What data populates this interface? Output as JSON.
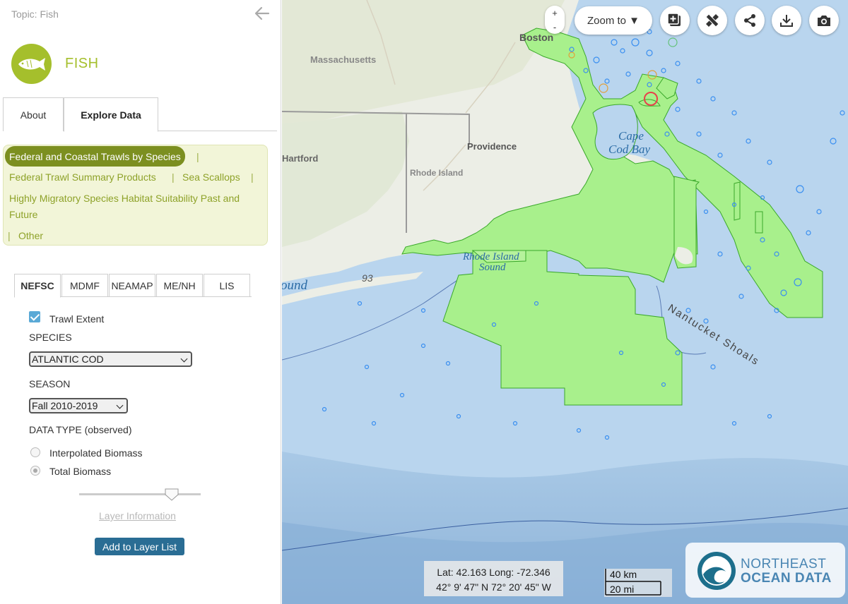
{
  "sidebar": {
    "topic": "Topic: Fish",
    "title": "FISH",
    "tabs": {
      "about": "About",
      "explore": "Explore Data"
    },
    "categories": {
      "active": "Federal and Coastal Trawls by Species",
      "items": [
        "Federal Trawl Summary Products",
        "Sea Scallops",
        "Highly Migratory Species Habitat Suitability Past and",
        "Future",
        "Other"
      ],
      "separator": "|"
    },
    "source_tabs": [
      "NEFSC",
      "MDMF",
      "NEAMAP",
      "ME/NH",
      "LIS"
    ],
    "trawl_extent": {
      "label": "Trawl Extent",
      "checked": true
    },
    "species": {
      "label": "SPECIES",
      "value": "ATLANTIC COD"
    },
    "season": {
      "label": "SEASON",
      "value": "Fall 2010-2019"
    },
    "data_type": {
      "label": "DATA TYPE (observed)",
      "options": [
        "Interpolated Biomass",
        "Total Biomass"
      ],
      "selected": "Total Biomass"
    },
    "opacity_slider": 0.77,
    "layer_info": "Layer Information",
    "add_button": "Add to Layer List"
  },
  "map": {
    "zoom_in": "+",
    "zoom_out": "-",
    "zoom_to": "Zoom to ▼",
    "tools": [
      "add-layer-icon",
      "measure-icon",
      "share-icon",
      "download-icon",
      "camera-icon"
    ],
    "labels": {
      "boston": "Boston",
      "massachusetts": "Massachusetts",
      "providence": "Providence",
      "hartford": "Hartford",
      "rhode_island": "Rhode Island",
      "cape_cod_bay_1": "Cape",
      "cape_cod_bay_2": "Cod Bay",
      "ri_sound_1": "Rhode Island",
      "ri_sound_2": "Sound",
      "sound": "ound",
      "depth": "93",
      "nantucket_shoals": "Nantucket Shoals"
    },
    "coords": {
      "line1": "Lat: 42.163 Long: -72.346",
      "line2": "42° 9' 47\" N 72° 20' 45\" W"
    },
    "scale": {
      "km": "40 km",
      "mi": "20 mi"
    },
    "logo": {
      "line1": "NORTHEAST",
      "line2": "OCEAN DATA"
    },
    "colors": {
      "trawl_fill": "#a8f08c",
      "trawl_stroke": "#3aa82a",
      "water": "#b7d3ec",
      "land": "#eceee6",
      "point": "#3a8ff0"
    }
  }
}
